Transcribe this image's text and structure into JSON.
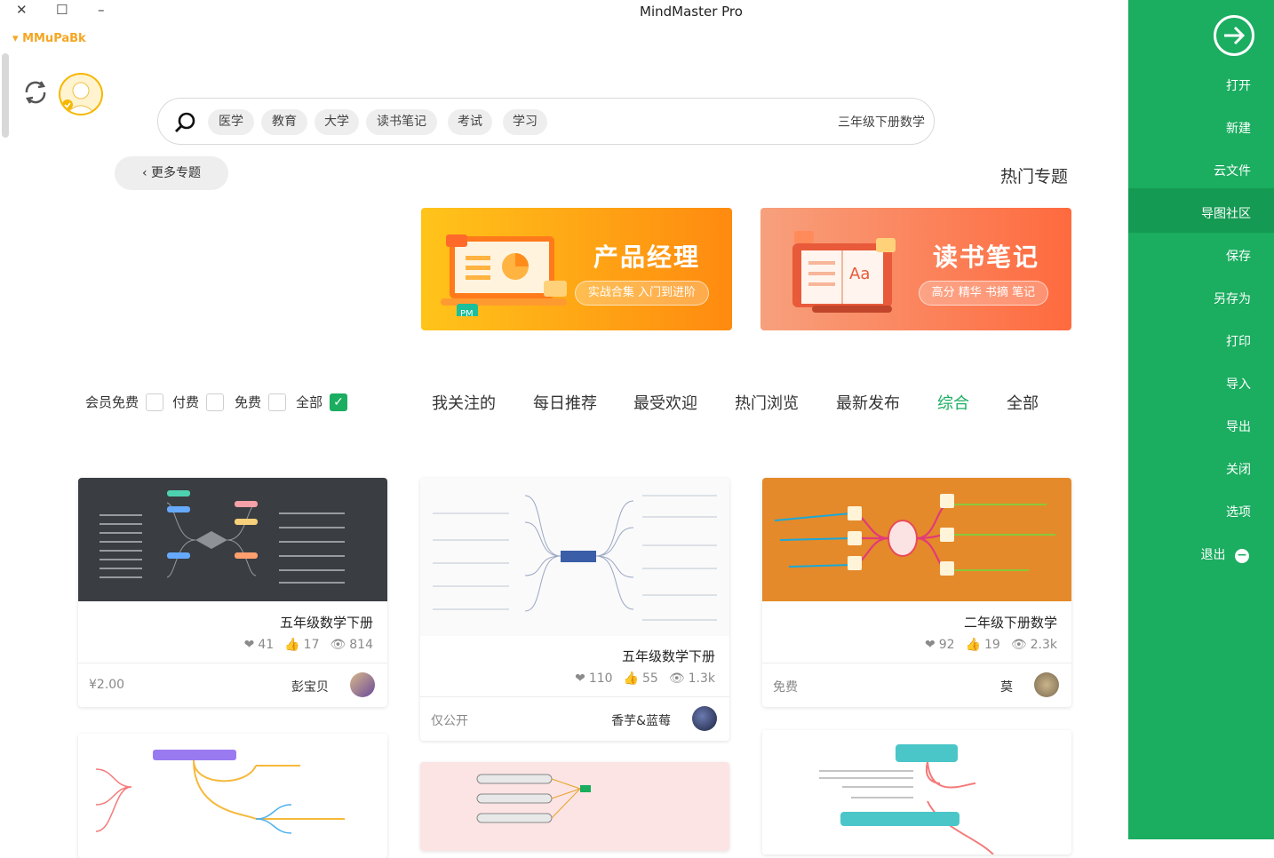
{
  "window": {
    "title": "MindMaster Pro",
    "brand": "MMuPaBk",
    "close": "✕",
    "maximize": "☐",
    "minimize": "–"
  },
  "search": {
    "value": "三年级下册数学",
    "chips": [
      "学习",
      "考试",
      "读书笔记",
      "大学",
      "教育",
      "医学"
    ]
  },
  "more_topics": "更多专题",
  "hot_topics": "热门专题",
  "banners": [
    {
      "title": "产品经理",
      "subtitle": "实战合集 入门到进阶",
      "badge": "PM"
    },
    {
      "title": "读书笔记",
      "subtitle": "高分 精华 书摘 笔记",
      "badge": "Aa"
    }
  ],
  "filters": [
    "全部",
    "免费",
    "付费",
    "会员免费"
  ],
  "tabs": [
    "全部",
    "综合",
    "最新发布",
    "热门浏览",
    "最受欢迎",
    "每日推荐",
    "我关注的"
  ],
  "cards": [
    {
      "title": "五年级数学下册",
      "views": "814",
      "likes": "17",
      "favs": "41",
      "author": "彭宝贝",
      "price": "¥2.00"
    },
    {
      "title": "五年级数学下册",
      "views": "1.3k",
      "likes": "55",
      "favs": "110",
      "author": "香芋&蓝莓",
      "price": "仅公开"
    },
    {
      "title": "二年级下册数学",
      "views": "2.3k",
      "likes": "19",
      "favs": "92",
      "author": "莫",
      "price": "免费"
    }
  ],
  "sidebar": {
    "items": [
      "打开",
      "新建",
      "云文件",
      "导图社区",
      "保存",
      "另存为",
      "打印",
      "导入",
      "导出",
      "关闭",
      "选项",
      "退出"
    ]
  },
  "colors": {
    "accent": "#1bad60",
    "brand": "#f5a623"
  }
}
